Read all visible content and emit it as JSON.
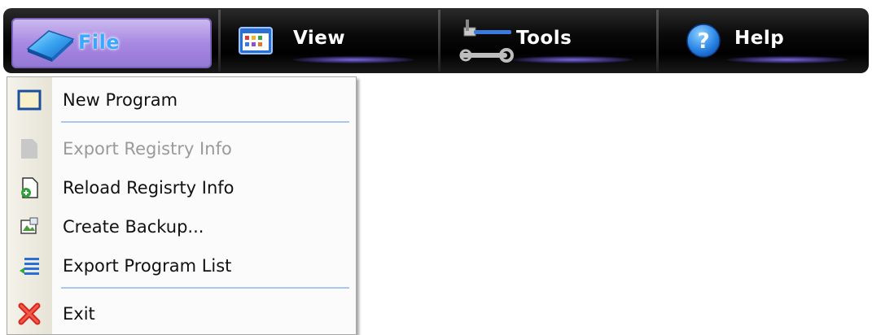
{
  "menubar": {
    "items": [
      {
        "label": "File",
        "icon": "file-folder-icon",
        "active": true
      },
      {
        "label": "View",
        "icon": "view-window-icon",
        "active": false
      },
      {
        "label": "Tools",
        "icon": "tools-hammer-wrench-icon",
        "active": false
      },
      {
        "label": "Help",
        "icon": "help-question-icon",
        "active": false
      }
    ]
  },
  "file_menu": {
    "items": [
      {
        "label": "New Program",
        "icon": "new-window-icon",
        "enabled": true
      },
      {
        "label": "Export Registry Info",
        "icon": "export-registry-icon",
        "enabled": false
      },
      {
        "label": "Reload Regisrty Info",
        "icon": "reload-page-icon",
        "enabled": true
      },
      {
        "label": "Create Backup...",
        "icon": "backup-image-icon",
        "enabled": true
      },
      {
        "label": "Export Program List",
        "icon": "export-list-icon",
        "enabled": true
      },
      {
        "label": "Exit",
        "icon": "exit-x-icon",
        "enabled": true
      }
    ]
  },
  "colors": {
    "menubar_bg": "#000000",
    "file_active_bg": "#a889e2",
    "separator": "#a9c6ee",
    "disabled_text": "#9a9a9a"
  }
}
